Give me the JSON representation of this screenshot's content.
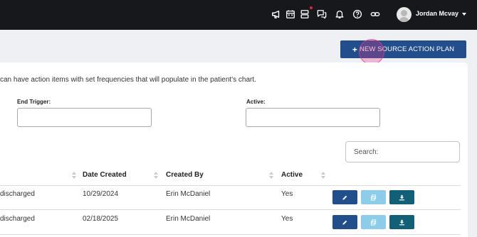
{
  "topbar": {
    "icons": [
      "megaphone-icon",
      "calendar-icon",
      "server-icon",
      "chat-icon",
      "bell-icon",
      "help-icon",
      "link-icon"
    ],
    "user_name": "Jordan Mcvay"
  },
  "new_button": {
    "label": "NEW SOURCE ACTION PLAN"
  },
  "description": "can have action items with set frequencies that will populate in the patient's chart.",
  "filters": {
    "end_trigger_label": "End Trigger:",
    "end_trigger_value": "",
    "active_label": "Active:",
    "active_value": ""
  },
  "search": {
    "placeholder": "Search:"
  },
  "table": {
    "columns": [
      "Date Created",
      "Created By",
      "Active"
    ],
    "rows": [
      {
        "trigger": "discharged",
        "date_created": "10/29/2024",
        "created_by": "Erin McDaniel",
        "active": "Yes"
      },
      {
        "trigger": "discharged",
        "date_created": "02/18/2025",
        "created_by": "Erin McDaniel",
        "active": "Yes"
      }
    ]
  },
  "colors": {
    "topbar": "#16181c",
    "primary": "#234e8c",
    "copy_button": "#8ecdea",
    "download_button": "#116077",
    "notification_dot": "#e0243a"
  }
}
